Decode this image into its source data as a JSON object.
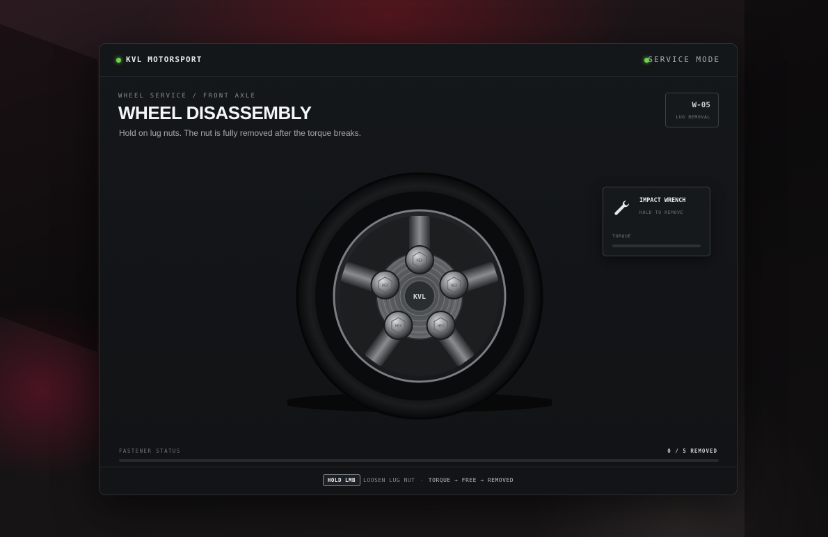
{
  "header": {
    "brand": "KVL MOTORSPORT",
    "mode": "SERVICE MODE",
    "status_color": "#6cd64a"
  },
  "main": {
    "breadcrumb": "WHEEL SERVICE / FRONT AXLE",
    "title": "WHEEL DISASSEMBLY",
    "subtitle": "Hold on lug nuts. The nut is fully removed after the torque breaks."
  },
  "stage": {
    "code": "W-05",
    "label": "LUG REMOVAL"
  },
  "tool": {
    "name": "IMPACT WRENCH",
    "hint": "HOLD TO REMOVE",
    "torque_label": "TORQUE",
    "torque_value": 0,
    "icon": "wrench-icon"
  },
  "wheel": {
    "hub_label": "KVL",
    "nut_label": "HEX",
    "nut_count": 5
  },
  "status": {
    "label": "FASTENER STATUS",
    "count_text": "0 / 5 REMOVED",
    "removed": 0,
    "total": 5
  },
  "footer": {
    "key": "HOLD LMB",
    "action": "LOOSEN LUG NUT",
    "separator": "·",
    "sequence": "TORQUE → FREE → REMOVED"
  }
}
